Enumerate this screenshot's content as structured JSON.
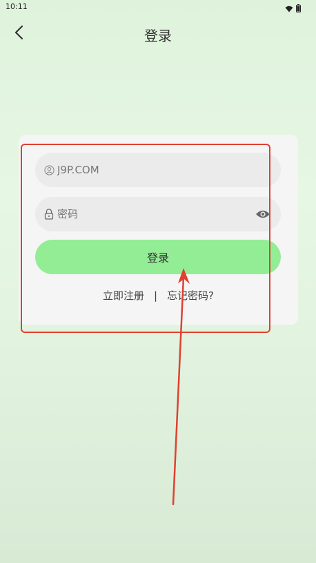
{
  "status_bar": {
    "time": "10:11",
    "icons": [
      "wifi-icon",
      "battery-icon"
    ]
  },
  "header": {
    "title": "登录",
    "back_icon": "chevron-left-icon"
  },
  "form": {
    "username": {
      "placeholder": "J9P.COM",
      "icon": "user-icon"
    },
    "password": {
      "placeholder": "密码",
      "icon": "lock-icon",
      "toggle_icon": "eye-icon"
    },
    "login_button": "登录",
    "register_link": "立即注册",
    "separator": "|",
    "forgot_link": "忘记密码?"
  },
  "colors": {
    "background": "#e2f3df",
    "card": "#f5f5f5",
    "field": "#ebebeb",
    "primary_button": "#93ed95",
    "annotation": "#e04030"
  }
}
